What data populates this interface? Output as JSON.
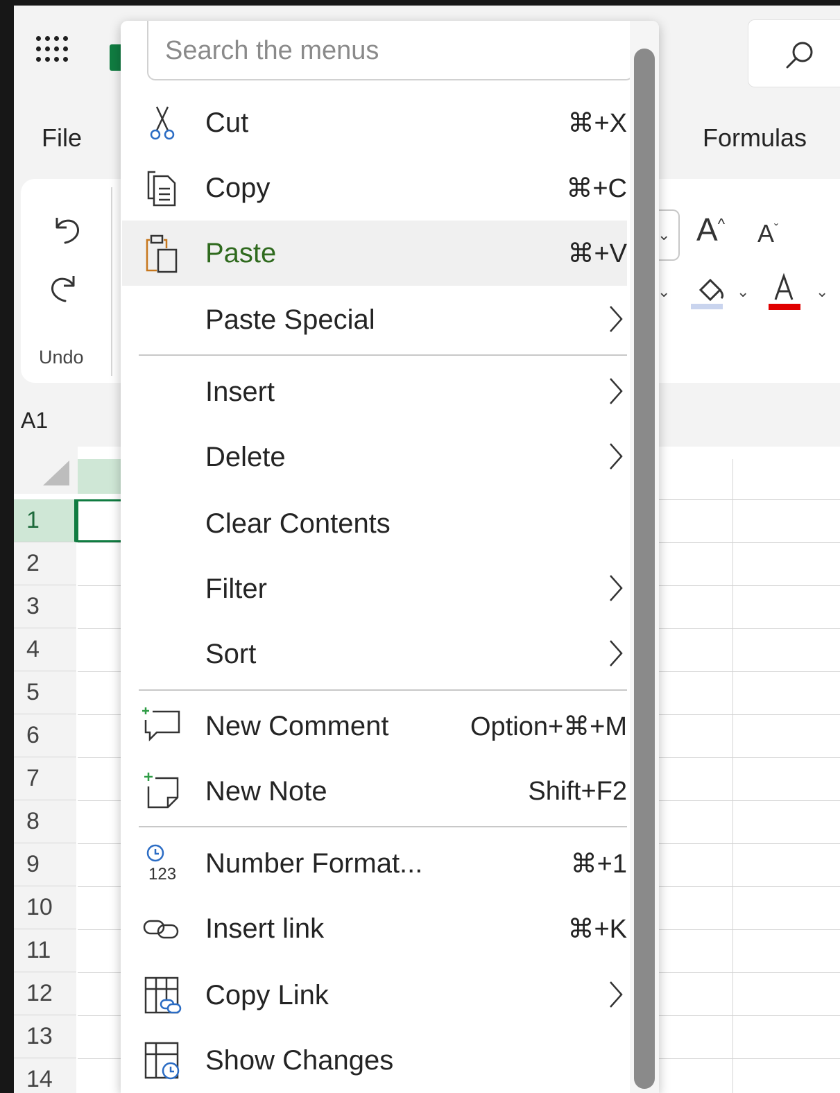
{
  "app": {
    "tabs": {
      "file": "File",
      "formulas": "Formulas"
    },
    "undo_group_label": "Undo",
    "name_box": "A1",
    "row_headers": [
      "1",
      "2",
      "3",
      "4",
      "5",
      "6",
      "7",
      "8",
      "9",
      "10",
      "11",
      "12",
      "13",
      "14"
    ],
    "selected_row": "1",
    "brand_color": "#107c41"
  },
  "context_menu": {
    "search_placeholder": "Search the menus",
    "highlighted_item": "Paste",
    "items": [
      {
        "label": "Cut",
        "shortcut": "⌘+X",
        "icon": "scissors-icon"
      },
      {
        "label": "Copy",
        "shortcut": "⌘+C",
        "icon": "copy-icon"
      },
      {
        "label": "Paste",
        "shortcut": "⌘+V",
        "icon": "paste-icon"
      },
      {
        "label": "Paste Special",
        "shortcut": "",
        "icon": "",
        "submenu": true
      },
      {
        "label": "Insert",
        "shortcut": "",
        "icon": "",
        "submenu": true
      },
      {
        "label": "Delete",
        "shortcut": "",
        "icon": "",
        "submenu": true
      },
      {
        "label": "Clear Contents",
        "shortcut": "",
        "icon": ""
      },
      {
        "label": "Filter",
        "shortcut": "",
        "icon": "",
        "submenu": true
      },
      {
        "label": "Sort",
        "shortcut": "",
        "icon": "",
        "submenu": true
      },
      {
        "label": "New Comment",
        "shortcut": "Option+⌘+M",
        "icon": "new-comment-icon"
      },
      {
        "label": "New Note",
        "shortcut": "Shift+F2",
        "icon": "new-note-icon"
      },
      {
        "label": "Number Format...",
        "shortcut": "⌘+1",
        "icon": "number-format-icon"
      },
      {
        "label": "Insert link",
        "shortcut": "⌘+K",
        "icon": "link-icon"
      },
      {
        "label": "Copy Link",
        "shortcut": "",
        "icon": "copy-link-icon",
        "submenu": true
      },
      {
        "label": "Show Changes",
        "shortcut": "",
        "icon": "show-changes-icon"
      }
    ],
    "highlight_marker_color": "#a5e87d"
  }
}
